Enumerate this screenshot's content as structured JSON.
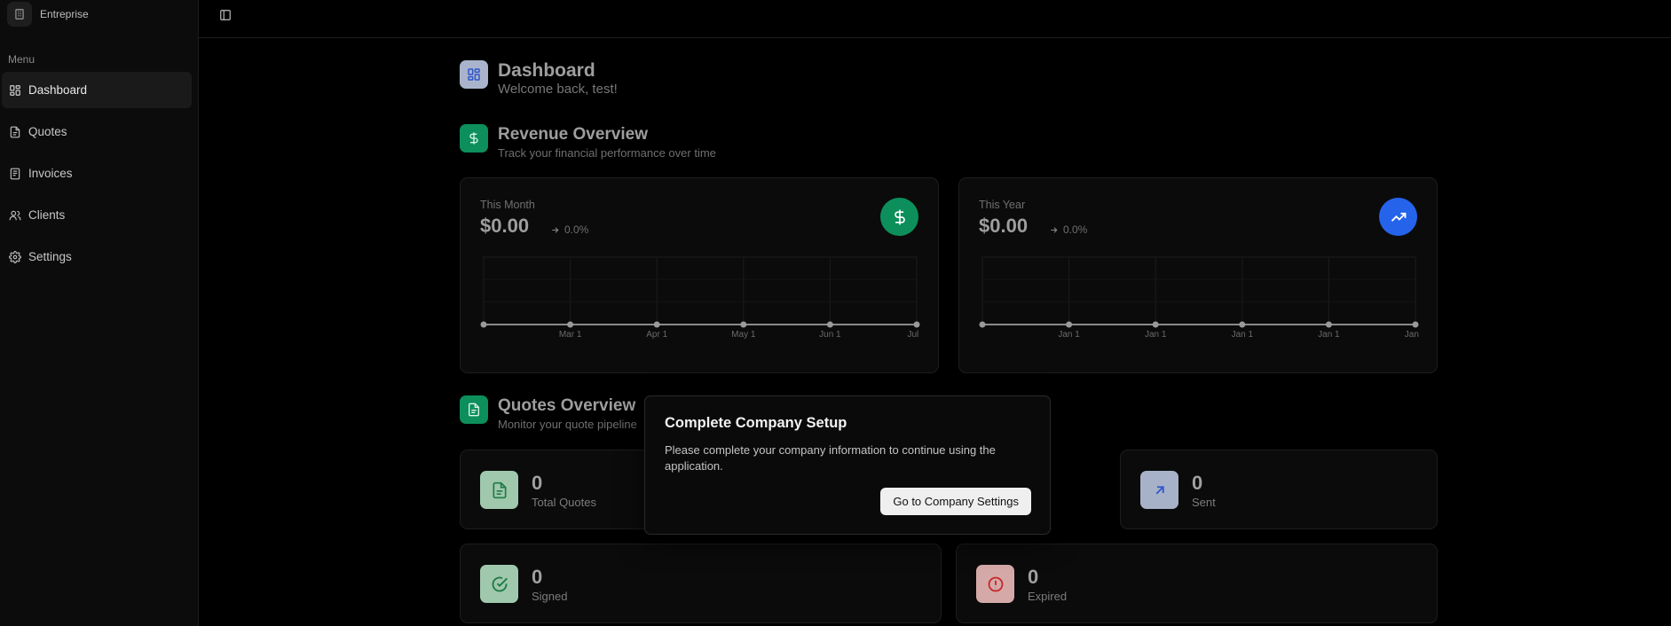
{
  "app": {
    "name": "Entreprise"
  },
  "sidebar": {
    "menu_label": "Menu",
    "items": [
      {
        "label": "Dashboard",
        "icon": "grid-icon",
        "active": true
      },
      {
        "label": "Quotes",
        "icon": "document-icon"
      },
      {
        "label": "Invoices",
        "icon": "receipt-icon"
      },
      {
        "label": "Clients",
        "icon": "users-icon"
      },
      {
        "label": "Settings",
        "icon": "gear-icon"
      }
    ]
  },
  "dashboard": {
    "title": "Dashboard",
    "subtitle": "Welcome back, test!"
  },
  "revenue": {
    "title": "Revenue Overview",
    "subtitle": "Track your financial performance over time",
    "month": {
      "label": "This Month",
      "amount": "$0.00",
      "change": "0.0%"
    },
    "year": {
      "label": "This Year",
      "amount": "$0.00",
      "change": "0.0%"
    }
  },
  "quotes": {
    "title": "Quotes Overview",
    "subtitle": "Monitor your quote pipeline",
    "stats": {
      "total": {
        "value": "0",
        "label": "Total Quotes"
      },
      "sent": {
        "value": "0",
        "label": "Sent"
      },
      "signed": {
        "value": "0",
        "label": "Signed"
      },
      "expired": {
        "value": "0",
        "label": "Expired"
      }
    }
  },
  "modal": {
    "title": "Complete Company Setup",
    "body": "Please complete your company information to continue using the application.",
    "button": "Go to Company Settings"
  },
  "colors": {
    "green": "#0d8f5b",
    "blue": "#2563eb",
    "red": "#d32f2f",
    "background": "#000000"
  },
  "chart_data": [
    {
      "type": "line",
      "x": [
        "",
        "Mar 1",
        "Apr 1",
        "May 1",
        "Jun 1",
        "Jul 1"
      ],
      "series": [
        {
          "values": [
            0,
            0,
            0,
            0,
            0,
            0
          ]
        }
      ],
      "grid": true
    },
    {
      "type": "line",
      "x": [
        "",
        "Jan 1",
        "Jan 1",
        "Jan 1",
        "Jan 1",
        "Jan 1"
      ],
      "series": [
        {
          "values": [
            0,
            0,
            0,
            0,
            0,
            0
          ]
        }
      ],
      "grid": true
    }
  ]
}
